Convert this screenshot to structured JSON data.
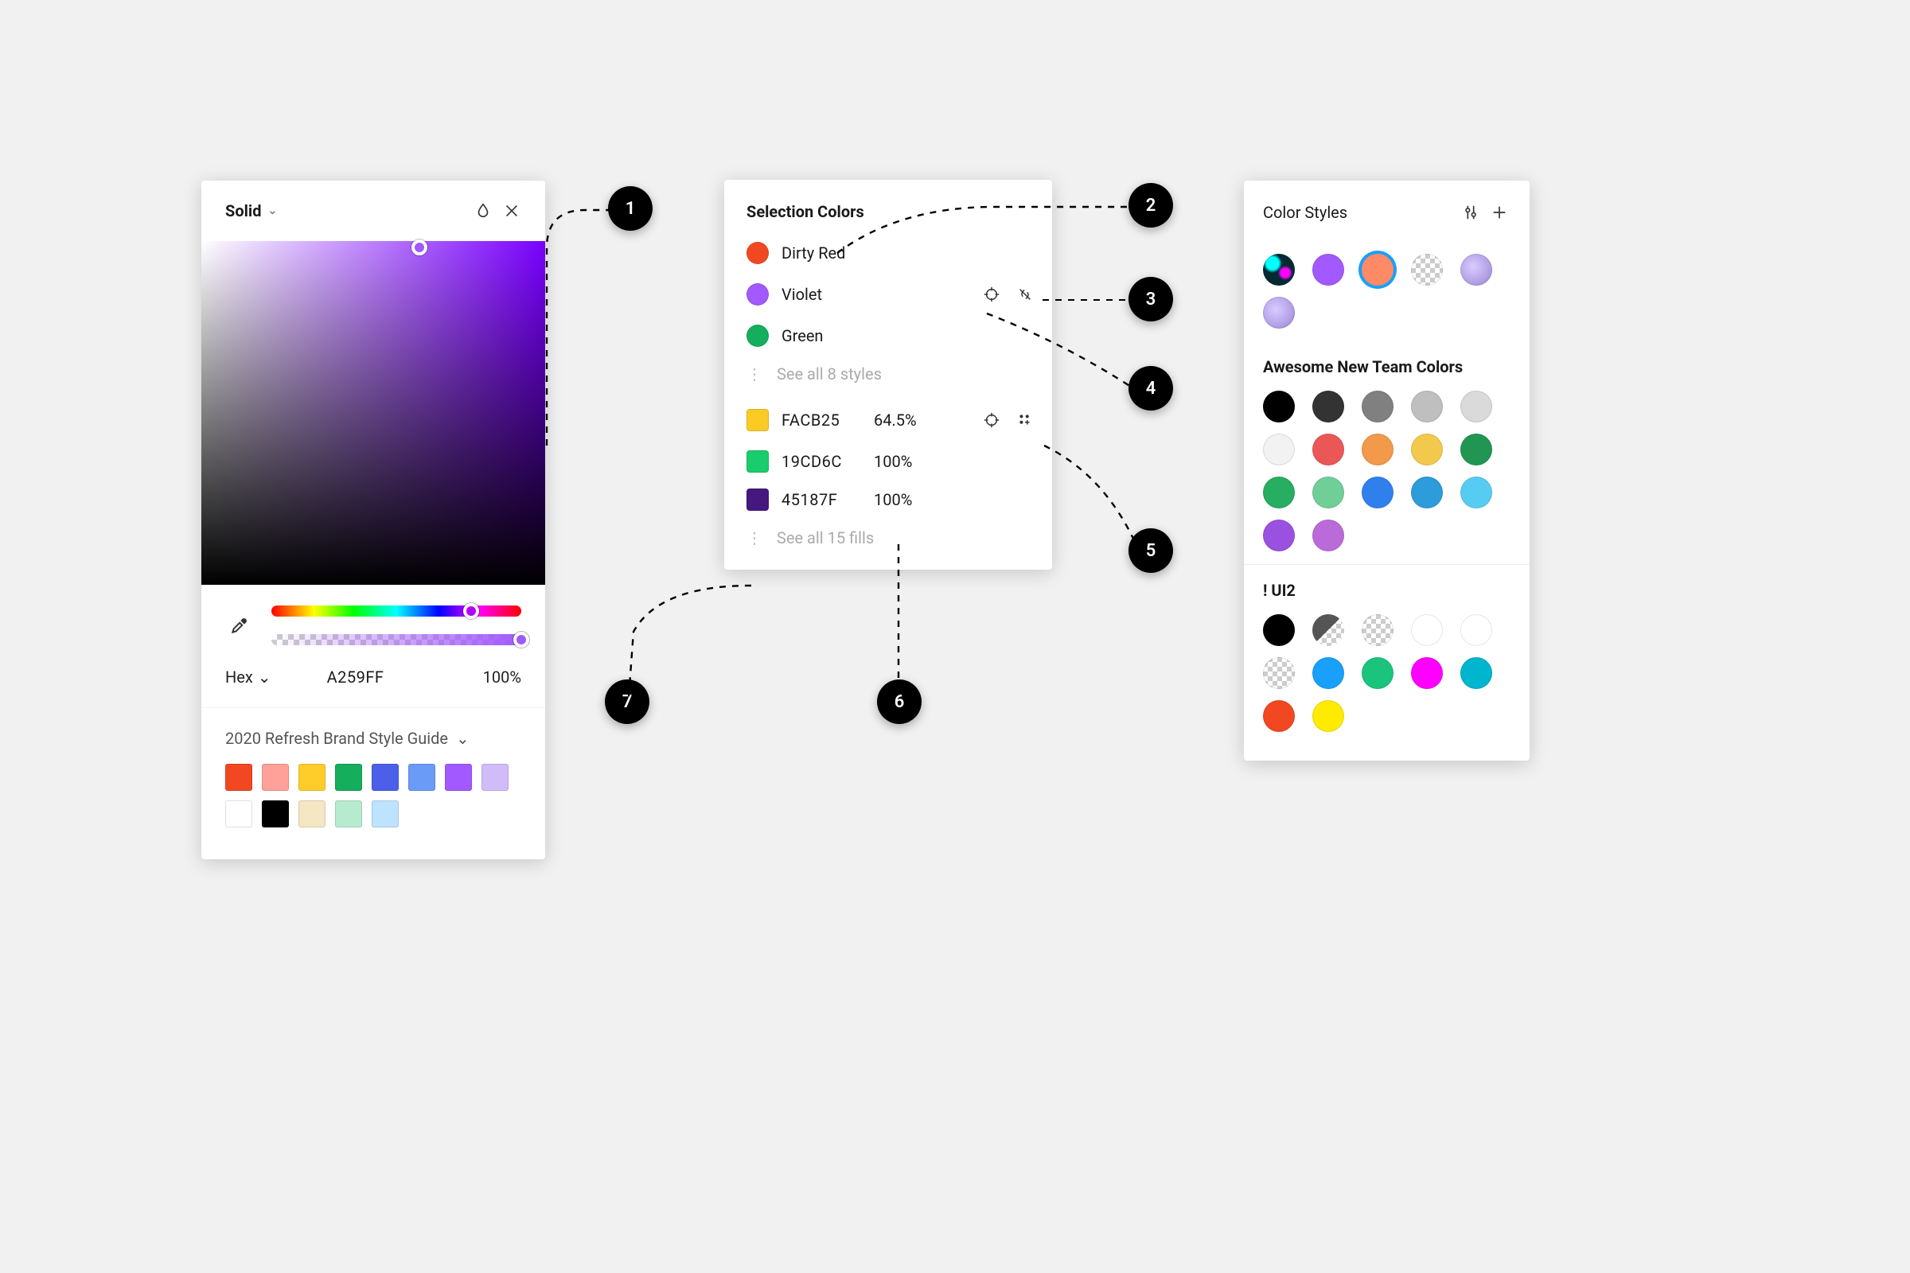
{
  "picker": {
    "fill_type": "Solid",
    "mode_label": "Hex",
    "hex_value": "A259FF",
    "opacity": "100%",
    "hue_thumb_pct": 80,
    "alpha_thumb_pct": 100,
    "doc_label": "2020 Refresh Brand Style Guide",
    "doc_swatches": [
      "#F24822",
      "#FFA199",
      "#FFCD29",
      "#14AE5C",
      "#4B5FE8",
      "#699BF7",
      "#A259FF",
      "#D1BCFA",
      "#FFFFFF",
      "#000000",
      "#F5E6C4",
      "#B6EBCF",
      "#BDE3FF"
    ]
  },
  "selection": {
    "title": "Selection Colors",
    "styles": [
      {
        "name": "Dirty Red",
        "color": "#F24822"
      },
      {
        "name": "Violet",
        "color": "#A259FF"
      },
      {
        "name": "Green",
        "color": "#14AE5C"
      }
    ],
    "see_styles": "See all 8 styles",
    "fills": [
      {
        "hex": "FACB25",
        "opacity": "64.5%",
        "color": "#FACB25"
      },
      {
        "hex": "19CD6C",
        "opacity": "100%",
        "color": "#19CD6C"
      },
      {
        "hex": "45187F",
        "opacity": "100%",
        "color": "#45187F"
      }
    ],
    "see_fills": "See all 15 fills"
  },
  "color_styles": {
    "title": "Color Styles",
    "recent": [
      {
        "kind": "img"
      },
      {
        "kind": "solid",
        "color": "#A259FF"
      },
      {
        "kind": "solid",
        "color": "#FF8A65",
        "selected": true
      },
      {
        "kind": "checker"
      },
      {
        "kind": "grain"
      },
      {
        "kind": "grain"
      }
    ],
    "sections": [
      {
        "name": "Awesome New Team Colors",
        "swatches": [
          "#000000",
          "#333333",
          "#808080",
          "#BFBFBF",
          "#DADADA",
          "#F2F2F2",
          "#EB5757",
          "#F2994A",
          "#F2C94C",
          "#219653",
          "#27AE60",
          "#6FCF97",
          "#2F80ED",
          "#2D9CDB",
          "#56CCF2",
          "#9B51E0",
          "#BB6BD9"
        ]
      },
      {
        "name": "! UI2",
        "swatches_mixed": [
          {
            "kind": "solid",
            "color": "#000000"
          },
          {
            "kind": "halfchecker"
          },
          {
            "kind": "checker"
          },
          {
            "kind": "solid",
            "color": "#FFFFFF"
          },
          {
            "kind": "solid",
            "color": "#FFFFFF"
          },
          {
            "kind": "checker"
          },
          {
            "kind": "solid",
            "color": "#18A0FB"
          },
          {
            "kind": "solid",
            "color": "#1BC47D"
          },
          {
            "kind": "solid",
            "color": "#FF00FF"
          },
          {
            "kind": "solid",
            "color": "#00B5CE"
          },
          {
            "kind": "solid",
            "color": "#F24822"
          },
          {
            "kind": "solid",
            "color": "#FFEB00"
          }
        ]
      }
    ]
  },
  "callouts": {
    "1": "1",
    "2": "2",
    "3": "3",
    "4": "4",
    "5": "5",
    "6": "6",
    "7": "7"
  }
}
